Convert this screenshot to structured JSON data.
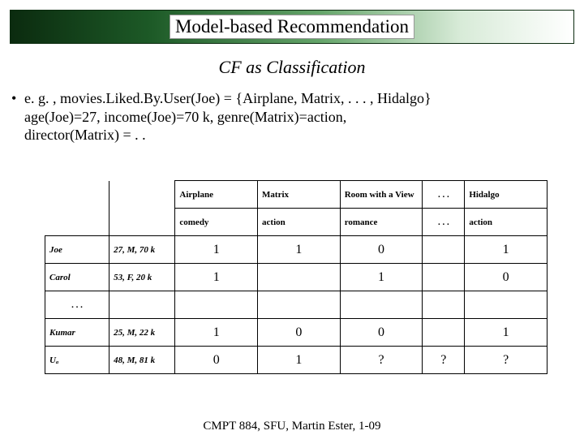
{
  "title": "Model-based Recommendation",
  "subtitle": "CF as Classification",
  "bullet": {
    "line1": "e. g. , movies.Liked.By.User(Joe) = {Airplane, Matrix, . . . , Hidalgo}",
    "line2": "age(Joe)=27, income(Joe)=70 k, genre(Matrix)=action,",
    "line3": "director(Matrix) = . ."
  },
  "columns": {
    "m1": "Airplane",
    "m2": "Matrix",
    "m3": "Room with a View",
    "mdots": ". . .",
    "m5": "Hidalgo"
  },
  "genres": {
    "g1": "comedy",
    "g2": "action",
    "g3": "romance",
    "gdots": ". . .",
    "g5": "action"
  },
  "rows": [
    {
      "user": "Joe",
      "demo": "27, M, 70 k",
      "v1": "1",
      "v2": "1",
      "v3": "0",
      "v4": "",
      "v5": "1"
    },
    {
      "user": "Carol",
      "demo": "53, F, 20 k",
      "v1": "1",
      "v2": "",
      "v3": "1",
      "v4": "",
      "v5": "0"
    },
    {
      "user": ". . .",
      "demo": "",
      "v1": "",
      "v2": "",
      "v3": "",
      "v4": "",
      "v5": ""
    },
    {
      "user": "Kumar",
      "demo": "25, M, 22 k",
      "v1": "1",
      "v2": "0",
      "v3": "0",
      "v4": "",
      "v5": "1"
    },
    {
      "user": "Uₐ",
      "demo": "48, M, 81 k",
      "v1": "0",
      "v2": "1",
      "v3": "?",
      "v4": "?",
      "v5": "?"
    }
  ],
  "footer": "CMPT 884, SFU, Martin Ester, 1-09"
}
